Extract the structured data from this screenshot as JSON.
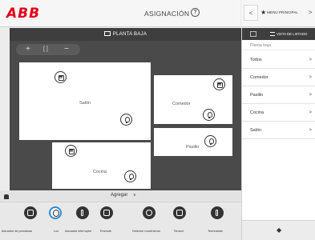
{
  "header": {
    "logo": "ABB",
    "title": "ASIGNACIÓN",
    "help": "?"
  },
  "topnav": {
    "prev": "<",
    "next": ">",
    "menu_label": "MENÚ PRINCIPAL"
  },
  "floor": {
    "name": "PLANTA BAJA",
    "zoom": {
      "plus": "+",
      "fit": "[ ]",
      "minus": "−"
    },
    "rooms": [
      {
        "name": "Salón"
      },
      {
        "name": "Comedor"
      },
      {
        "name": "Pasillo"
      },
      {
        "name": "Cocina"
      }
    ]
  },
  "addbar": {
    "label": "Agregar",
    "chevron": "∨"
  },
  "toolbar": {
    "items": [
      {
        "label": "Actuador de persianas",
        "icon": "blind-icon"
      },
      {
        "label": "Luz",
        "icon": "light-icon",
        "active": true
      },
      {
        "label": "Actuador interruptor",
        "icon": "switch-icon"
      },
      {
        "label": "Enchufe",
        "icon": "socket-icon"
      },
      {
        "label": "Detector movimiento",
        "icon": "motion-icon"
      },
      {
        "label": "Sensor",
        "icon": "sensor-icon"
      },
      {
        "label": "Termostato",
        "icon": "thermostat-icon"
      }
    ]
  },
  "sidebar": {
    "header_label": "VISTA DE LISTADO",
    "subheader": "Planta baja",
    "items": [
      {
        "label": "Todos"
      },
      {
        "label": "Comedor"
      },
      {
        "label": "Pasillo"
      },
      {
        "label": "Cocina"
      },
      {
        "label": "Salón"
      }
    ],
    "chevron": ">",
    "back": "◆"
  },
  "colors": {
    "brand": "#e2001a",
    "accent": "#2d8ad6",
    "dark": "#4a4a4a"
  }
}
